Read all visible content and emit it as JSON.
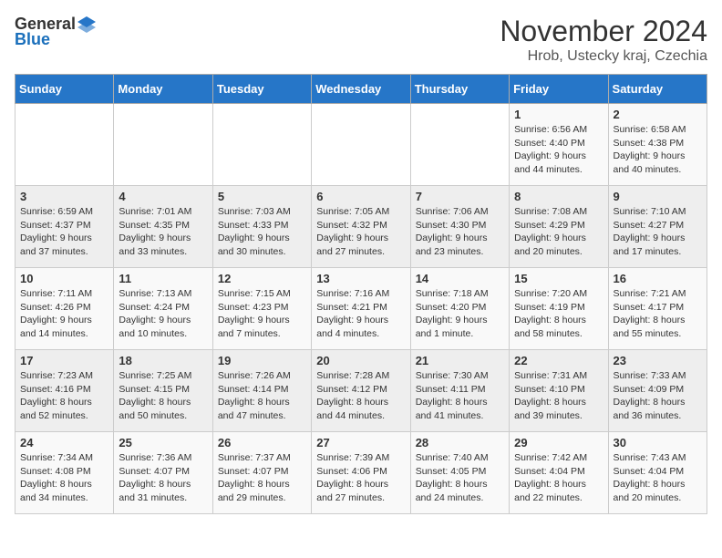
{
  "header": {
    "logo_general": "General",
    "logo_blue": "Blue",
    "month_title": "November 2024",
    "location": "Hrob, Ustecky kraj, Czechia"
  },
  "weekdays": [
    "Sunday",
    "Monday",
    "Tuesday",
    "Wednesday",
    "Thursday",
    "Friday",
    "Saturday"
  ],
  "weeks": [
    [
      {
        "day": "",
        "info": ""
      },
      {
        "day": "",
        "info": ""
      },
      {
        "day": "",
        "info": ""
      },
      {
        "day": "",
        "info": ""
      },
      {
        "day": "",
        "info": ""
      },
      {
        "day": "1",
        "info": "Sunrise: 6:56 AM\nSunset: 4:40 PM\nDaylight: 9 hours and 44 minutes."
      },
      {
        "day": "2",
        "info": "Sunrise: 6:58 AM\nSunset: 4:38 PM\nDaylight: 9 hours and 40 minutes."
      }
    ],
    [
      {
        "day": "3",
        "info": "Sunrise: 6:59 AM\nSunset: 4:37 PM\nDaylight: 9 hours and 37 minutes."
      },
      {
        "day": "4",
        "info": "Sunrise: 7:01 AM\nSunset: 4:35 PM\nDaylight: 9 hours and 33 minutes."
      },
      {
        "day": "5",
        "info": "Sunrise: 7:03 AM\nSunset: 4:33 PM\nDaylight: 9 hours and 30 minutes."
      },
      {
        "day": "6",
        "info": "Sunrise: 7:05 AM\nSunset: 4:32 PM\nDaylight: 9 hours and 27 minutes."
      },
      {
        "day": "7",
        "info": "Sunrise: 7:06 AM\nSunset: 4:30 PM\nDaylight: 9 hours and 23 minutes."
      },
      {
        "day": "8",
        "info": "Sunrise: 7:08 AM\nSunset: 4:29 PM\nDaylight: 9 hours and 20 minutes."
      },
      {
        "day": "9",
        "info": "Sunrise: 7:10 AM\nSunset: 4:27 PM\nDaylight: 9 hours and 17 minutes."
      }
    ],
    [
      {
        "day": "10",
        "info": "Sunrise: 7:11 AM\nSunset: 4:26 PM\nDaylight: 9 hours and 14 minutes."
      },
      {
        "day": "11",
        "info": "Sunrise: 7:13 AM\nSunset: 4:24 PM\nDaylight: 9 hours and 10 minutes."
      },
      {
        "day": "12",
        "info": "Sunrise: 7:15 AM\nSunset: 4:23 PM\nDaylight: 9 hours and 7 minutes."
      },
      {
        "day": "13",
        "info": "Sunrise: 7:16 AM\nSunset: 4:21 PM\nDaylight: 9 hours and 4 minutes."
      },
      {
        "day": "14",
        "info": "Sunrise: 7:18 AM\nSunset: 4:20 PM\nDaylight: 9 hours and 1 minute."
      },
      {
        "day": "15",
        "info": "Sunrise: 7:20 AM\nSunset: 4:19 PM\nDaylight: 8 hours and 58 minutes."
      },
      {
        "day": "16",
        "info": "Sunrise: 7:21 AM\nSunset: 4:17 PM\nDaylight: 8 hours and 55 minutes."
      }
    ],
    [
      {
        "day": "17",
        "info": "Sunrise: 7:23 AM\nSunset: 4:16 PM\nDaylight: 8 hours and 52 minutes."
      },
      {
        "day": "18",
        "info": "Sunrise: 7:25 AM\nSunset: 4:15 PM\nDaylight: 8 hours and 50 minutes."
      },
      {
        "day": "19",
        "info": "Sunrise: 7:26 AM\nSunset: 4:14 PM\nDaylight: 8 hours and 47 minutes."
      },
      {
        "day": "20",
        "info": "Sunrise: 7:28 AM\nSunset: 4:12 PM\nDaylight: 8 hours and 44 minutes."
      },
      {
        "day": "21",
        "info": "Sunrise: 7:30 AM\nSunset: 4:11 PM\nDaylight: 8 hours and 41 minutes."
      },
      {
        "day": "22",
        "info": "Sunrise: 7:31 AM\nSunset: 4:10 PM\nDaylight: 8 hours and 39 minutes."
      },
      {
        "day": "23",
        "info": "Sunrise: 7:33 AM\nSunset: 4:09 PM\nDaylight: 8 hours and 36 minutes."
      }
    ],
    [
      {
        "day": "24",
        "info": "Sunrise: 7:34 AM\nSunset: 4:08 PM\nDaylight: 8 hours and 34 minutes."
      },
      {
        "day": "25",
        "info": "Sunrise: 7:36 AM\nSunset: 4:07 PM\nDaylight: 8 hours and 31 minutes."
      },
      {
        "day": "26",
        "info": "Sunrise: 7:37 AM\nSunset: 4:07 PM\nDaylight: 8 hours and 29 minutes."
      },
      {
        "day": "27",
        "info": "Sunrise: 7:39 AM\nSunset: 4:06 PM\nDaylight: 8 hours and 27 minutes."
      },
      {
        "day": "28",
        "info": "Sunrise: 7:40 AM\nSunset: 4:05 PM\nDaylight: 8 hours and 24 minutes."
      },
      {
        "day": "29",
        "info": "Sunrise: 7:42 AM\nSunset: 4:04 PM\nDaylight: 8 hours and 22 minutes."
      },
      {
        "day": "30",
        "info": "Sunrise: 7:43 AM\nSunset: 4:04 PM\nDaylight: 8 hours and 20 minutes."
      }
    ]
  ]
}
